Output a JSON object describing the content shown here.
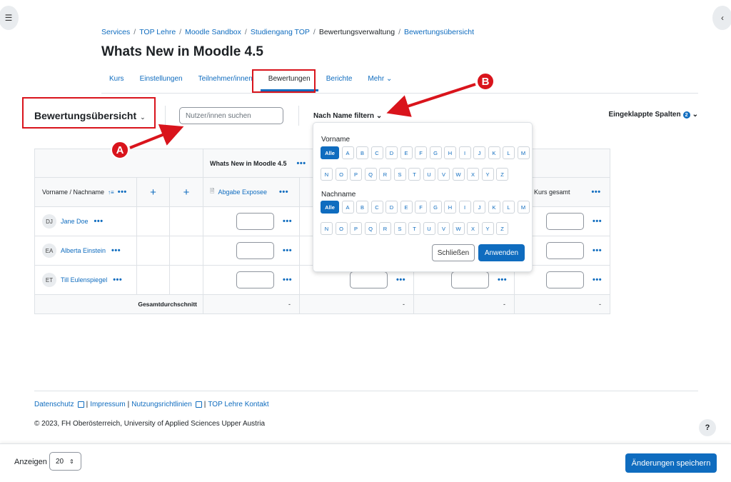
{
  "icons": {
    "drawer_left": "☰",
    "drawer_right": "‹",
    "chevron": "⌄",
    "dots": "•••",
    "plus": "+",
    "sort": "↑≡",
    "file": "🗎",
    "help": "?"
  },
  "breadcrumb": {
    "items": [
      "Services",
      "TOP Lehre",
      "Moodle Sandbox",
      "Studiengang TOP",
      "Bewertungsverwaltung",
      "Bewertungsübersicht"
    ],
    "separator": "/"
  },
  "page_title": "Whats New in Moodle 4.5",
  "nav": {
    "tabs": [
      "Kurs",
      "Einstellungen",
      "Teilnehmer/innen",
      "Bewertungen",
      "Berichte",
      "Mehr"
    ],
    "active_tab": "Bewertungen",
    "more_chevron": "⌄"
  },
  "toolbar": {
    "report_title": "Bewertungsübersicht",
    "search_placeholder": "Nutzer/innen suchen",
    "name_filter_label": "Nach Name filtern",
    "collapsed_columns_label": "Eingeklappte Spalten",
    "collapsed_count": "2"
  },
  "table": {
    "course_header": "Whats New in Moodle 4.5",
    "name_column_header": "Vorname / Nachname",
    "assignment_header": "Abgabe Exposee",
    "course_total_header": "Kurs gesamt",
    "rows": [
      {
        "initials": "DJ",
        "name": "Jane Doe"
      },
      {
        "initials": "EA",
        "name": "Alberta Einstein"
      },
      {
        "initials": "ET",
        "name": "Till Eulenspiegel"
      }
    ],
    "overall_average_label": "Gesamtdurchschnitt",
    "overall_values": [
      "-",
      "-",
      "-",
      "-"
    ]
  },
  "name_filter_popup": {
    "first_name_label": "Vorname",
    "last_name_label": "Nachname",
    "all_label": "Alle",
    "letters_row1": [
      "A",
      "B",
      "C",
      "D",
      "E",
      "F",
      "G",
      "H",
      "I",
      "J",
      "K",
      "L",
      "M"
    ],
    "letters_row2": [
      "N",
      "O",
      "P",
      "Q",
      "R",
      "S",
      "T",
      "U",
      "V",
      "W",
      "X",
      "Y",
      "Z"
    ],
    "close_button": "Schließen",
    "apply_button": "Anwenden"
  },
  "annotations": {
    "marker_a": "A",
    "marker_b": "B",
    "color": "#d9141c"
  },
  "footer": {
    "links": [
      "Datenschutz",
      "Impressum",
      "Nutzungsrichtlinien",
      "TOP Lehre Kontakt"
    ],
    "copyright": "© 2023, FH Oberösterreich, University of Applied Sciences Upper Austria"
  },
  "bottom_bar": {
    "show_label": "Anzeigen",
    "per_page_value": "20",
    "save_button": "Änderungen speichern"
  },
  "colors": {
    "accent": "#0f6cbf",
    "highlight": "#d9141c"
  }
}
